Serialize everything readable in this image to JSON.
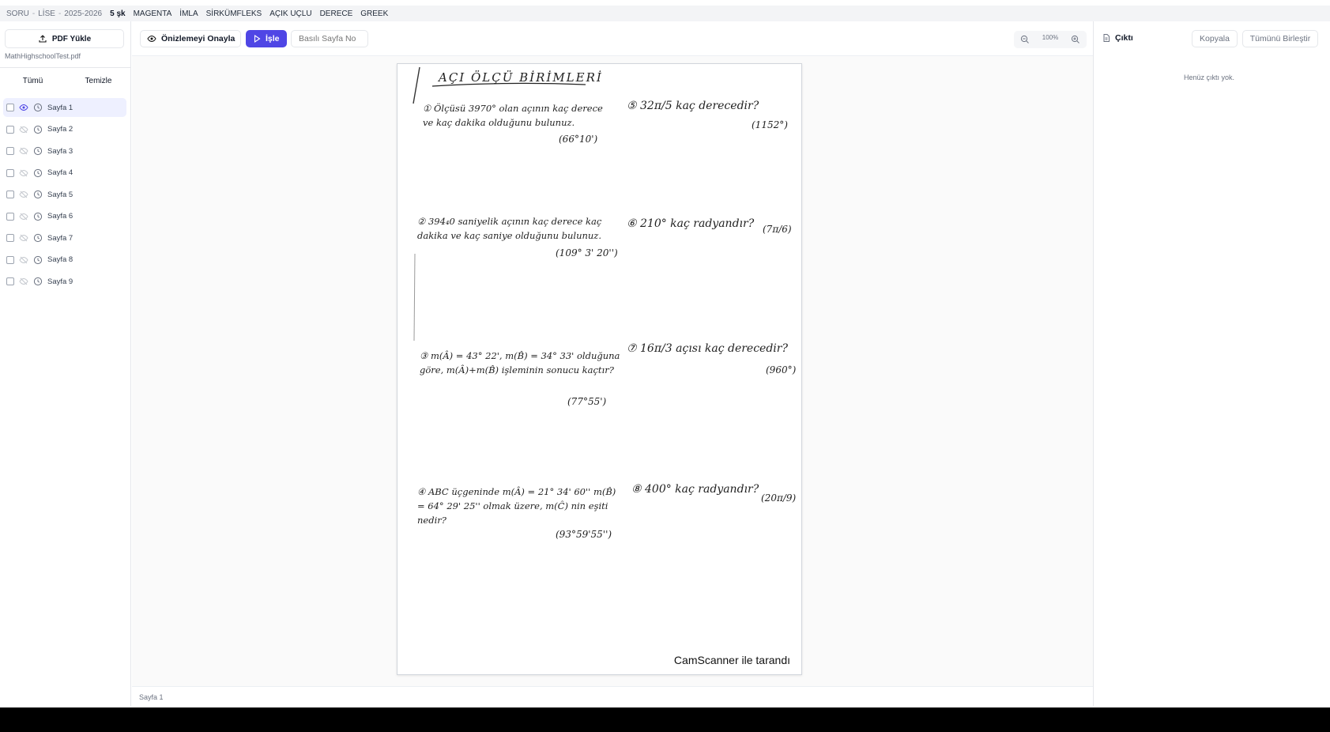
{
  "topbar": {
    "meta": [
      "SORU",
      "LİSE",
      "2025-2026"
    ],
    "count": "5 şk",
    "tags": [
      "MAGENTA",
      "İMLA",
      "SİRKÜMFLEKS",
      "AÇIK UÇLU",
      "DERECE",
      "GREEK"
    ]
  },
  "sidebar": {
    "upload_label": "PDF Yükle",
    "file_name": "MathHighschoolTest.pdf",
    "tab_all": "Tümü",
    "tab_clear": "Temizle",
    "pages": [
      {
        "label": "Sayfa 1",
        "active": true
      },
      {
        "label": "Sayfa 2"
      },
      {
        "label": "Sayfa 3"
      },
      {
        "label": "Sayfa 4"
      },
      {
        "label": "Sayfa 5"
      },
      {
        "label": "Sayfa 6"
      },
      {
        "label": "Sayfa 7"
      },
      {
        "label": "Sayfa 8"
      },
      {
        "label": "Sayfa 9"
      }
    ]
  },
  "toolbar": {
    "preview_label": "Önizlemeyi Onayla",
    "run_label": "İşle",
    "page_no_placeholder": "Basılı Sayfa No",
    "zoom": "100%"
  },
  "document": {
    "title": "AÇI ÖLÇÜ BİRİMLERİ",
    "scan_mark": "CamScanner ile tarandı",
    "q1": "① Ölçüsü 3970° olan açının kaç derece ve kaç dakika olduğunu bulunuz.",
    "a1": "(66°10')",
    "q5": "⑤ 32π/5 kaç derecedir?",
    "a5": "(1152°)",
    "q2": "② 394₄0 saniyelik açının kaç derece kaç dakika ve kaç saniye olduğunu bulunuz.",
    "a2": "(109° 3' 20'')",
    "q6": "⑥ 210° kaç radyandır?",
    "a6": "(7π/6)",
    "q3": "③ m(Â) = 43° 22', m(B̂) = 34° 33' olduğuna göre, m(Â)+m(B̂) işleminin sonucu kaçtır?",
    "a3": "(77°55')",
    "q7": "⑦ 16π/3 açısı kaç derecedir?",
    "a7": "(960°)",
    "q4": "④ ABC üçgeninde m(Â) = 21° 34' 60'' m(B̂) = 64° 29' 25'' olmak üzere, m(Ĉ) nin eşiti nedir?",
    "a4": "(93°59'55'')",
    "q8": "⑧ 400° kaç radyandır?",
    "a8": "(20π/9)"
  },
  "status": {
    "page": "Sayfa 1"
  },
  "output": {
    "title": "Çıktı",
    "copy_label": "Kopyala",
    "merge_label": "Tümünü Birleştir",
    "empty": "Henüz çıktı yok."
  },
  "colors": {
    "accent": "#4f46e5",
    "active_row": "#eef0ff"
  }
}
